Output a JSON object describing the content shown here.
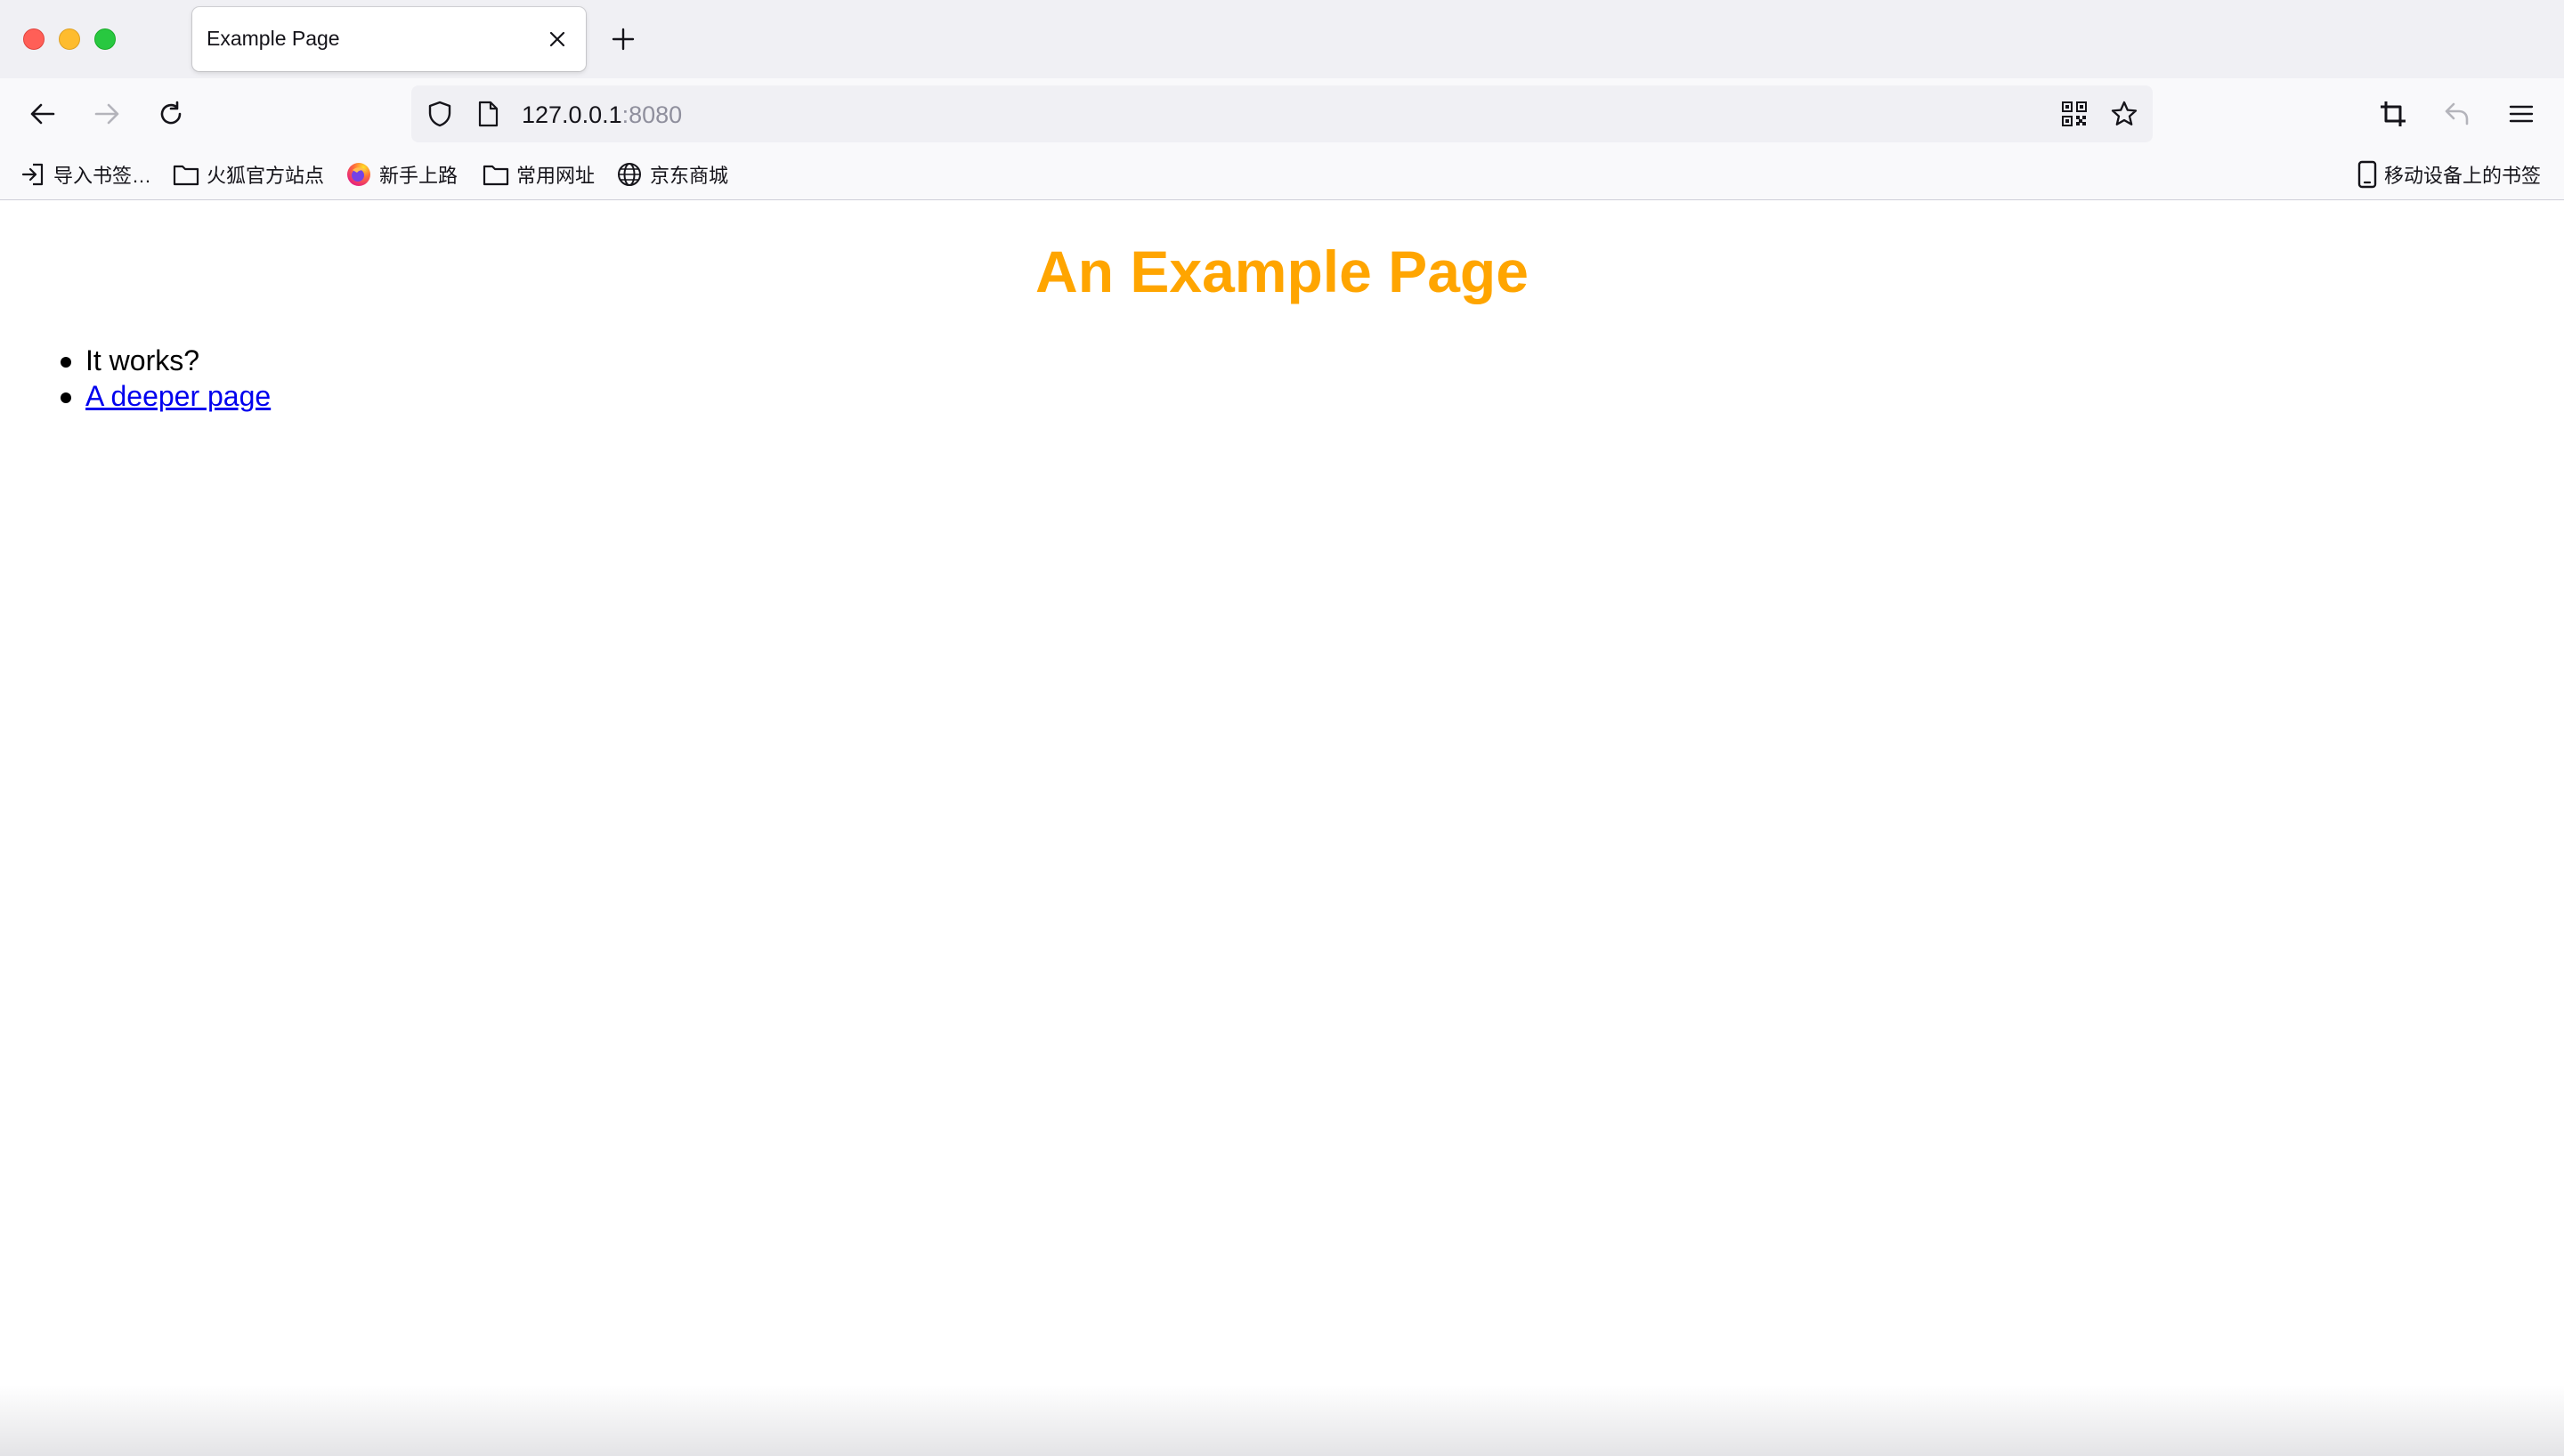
{
  "browser": {
    "tab": {
      "title": "Example Page"
    },
    "address": {
      "host": "127.0.0.1",
      "port": ":8080"
    },
    "icons": {
      "back": "arrow-left-icon",
      "forward": "arrow-right-icon",
      "reload": "reload-icon",
      "shield": "shield-icon",
      "page": "page-icon",
      "qr": "qr-code-icon",
      "bookmark_star": "star-icon",
      "screenshot": "crop-icon",
      "undo": "undo-icon",
      "menu": "hamburger-menu-icon"
    },
    "bookmarks": [
      {
        "label": "导入书签…",
        "icon": "import-icon"
      },
      {
        "label": "火狐官方站点",
        "icon": "folder-icon"
      },
      {
        "label": "新手上路",
        "icon": "firefox-icon"
      },
      {
        "label": "常用网址",
        "icon": "folder-icon"
      },
      {
        "label": "京东商城",
        "icon": "globe-icon"
      }
    ],
    "mobile_bookmarks": {
      "label": "移动设备上的书签",
      "icon": "mobile-device-icon"
    }
  },
  "page": {
    "heading": "An Example Page",
    "heading_color": "#ffa500",
    "items": [
      {
        "text": "It works?"
      },
      {
        "text": "A deeper page",
        "link": true
      }
    ]
  }
}
